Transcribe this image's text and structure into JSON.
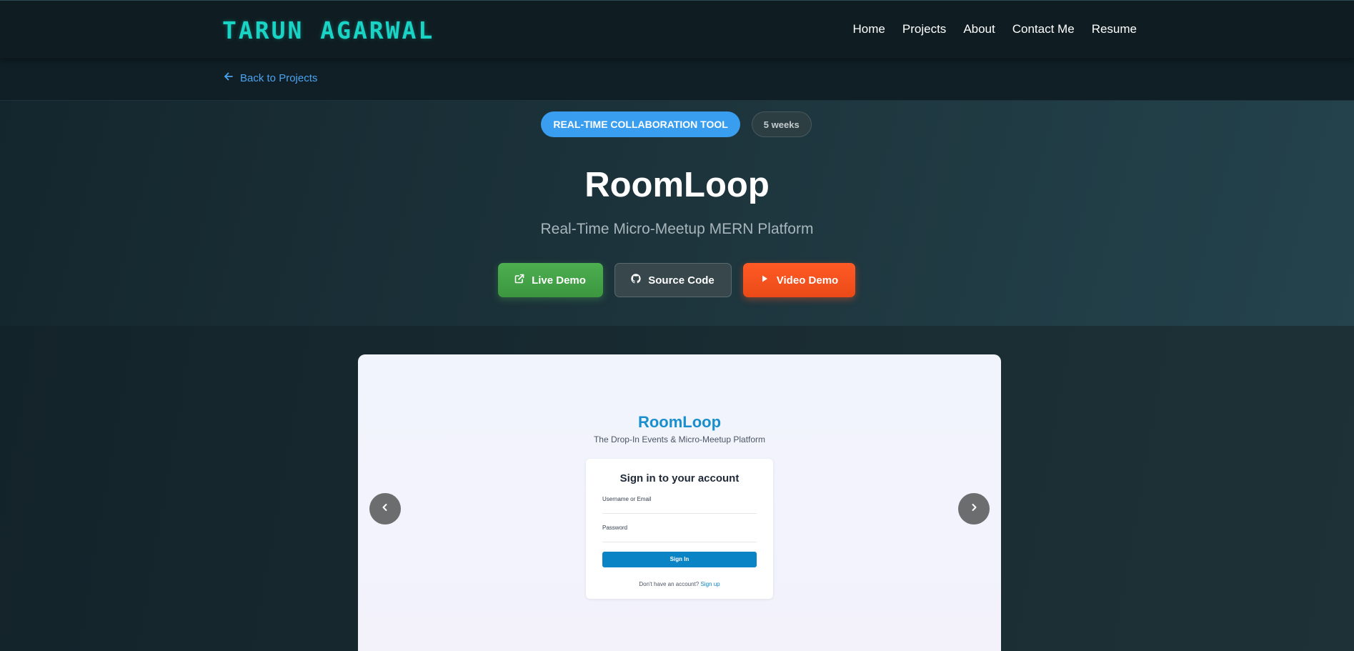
{
  "nav": {
    "logo": "TARUN AGARWAL",
    "links": [
      "Home",
      "Projects",
      "About",
      "Contact Me",
      "Resume"
    ]
  },
  "back": {
    "label": "Back to Projects",
    "icon": "arrow-left-icon"
  },
  "hero": {
    "category_badge": "REAL-TIME COLLABORATION TOOL",
    "duration_badge": "5 weeks",
    "title": "RoomLoop",
    "subtitle": "Real-Time Micro-Meetup MERN Platform",
    "buttons": {
      "live": "Live Demo",
      "source": "Source Code",
      "video": "Video Demo"
    }
  },
  "screenshot": {
    "brand": "RoomLoop",
    "tagline": "The Drop-In Events & Micro-Meetup Platform",
    "card_title": "Sign in to your account",
    "username_label": "Username or Email",
    "password_label": "Password",
    "signin_button": "Sign In",
    "signup_prompt": "Don't have an account?",
    "signup_link": "Sign up"
  },
  "colors": {
    "logo": "#19d3c5",
    "accent_blue": "#3a9ef0",
    "live_green": "#4caf50",
    "video_orange": "#ff5722",
    "brand_blue": "#1a8fcd"
  }
}
